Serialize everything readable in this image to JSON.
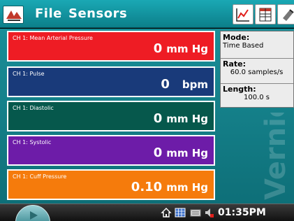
{
  "menu": {
    "file": "File",
    "sensors": "Sensors"
  },
  "meters": [
    {
      "label": "CH 1: Mean Arterial Pressure",
      "value": "0",
      "unit": "mm Hg",
      "color": "#ee1c24"
    },
    {
      "label": "CH 1: Pulse",
      "value": "0",
      "unit": "bpm",
      "color": "#193a7a"
    },
    {
      "label": "CH 1: Diastolic",
      "value": "0",
      "unit": "mm Hg",
      "color": "#06584c"
    },
    {
      "label": "CH 1: Systolic",
      "value": "0",
      "unit": "mm Hg",
      "color": "#6d1ca8"
    },
    {
      "label": "CH 1: Cuff Pressure",
      "value": "0.10",
      "unit": "mm Hg",
      "color": "#f57b0c"
    }
  ],
  "info": {
    "mode_label": "Mode:",
    "mode_value": "Time Based",
    "rate_label": "Rate:",
    "rate_value": "60.0 samples/s",
    "length_label": "Length:",
    "length_value": "100.0 s"
  },
  "watermark": "Vernier",
  "taskbar": {
    "clock": "01:35PM"
  },
  "icons": {
    "app": "app-logo-icon",
    "graph": "graph-view-icon",
    "table": "table-view-icon",
    "notes": "notes-view-icon",
    "start": "play-icon",
    "home": "home-icon",
    "grid": "grid-icon",
    "keyboard": "keyboard-icon",
    "volume": "volume-icon"
  }
}
